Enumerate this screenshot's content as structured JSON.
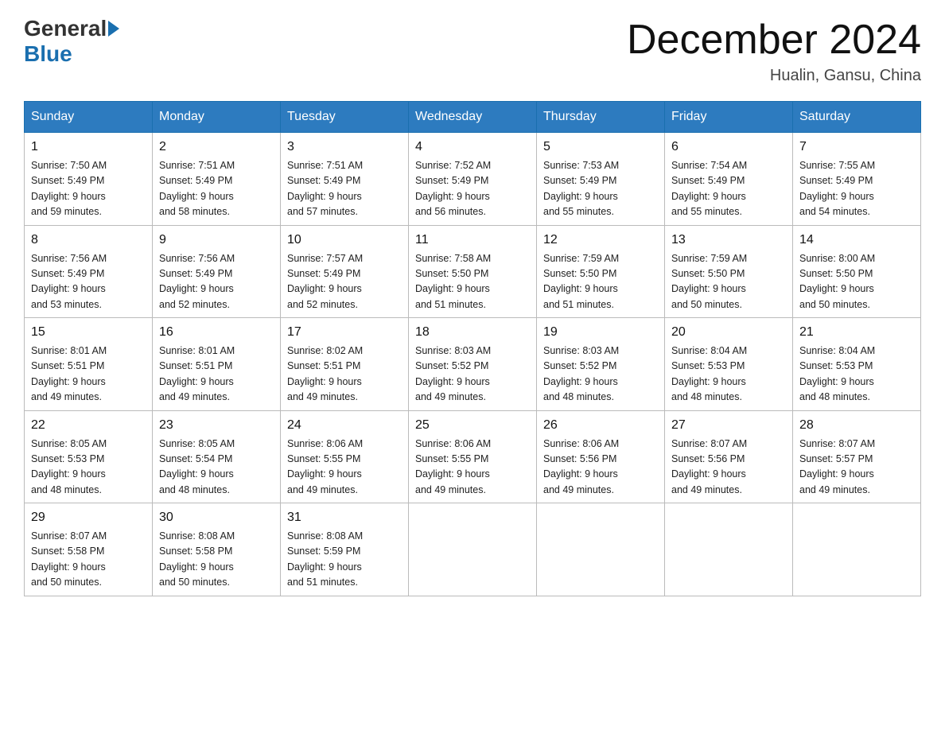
{
  "logo": {
    "general": "General",
    "blue": "Blue"
  },
  "title": "December 2024",
  "location": "Hualin, Gansu, China",
  "days_of_week": [
    "Sunday",
    "Monday",
    "Tuesday",
    "Wednesday",
    "Thursday",
    "Friday",
    "Saturday"
  ],
  "weeks": [
    [
      {
        "day": "1",
        "sunrise": "7:50 AM",
        "sunset": "5:49 PM",
        "daylight": "9 hours and 59 minutes."
      },
      {
        "day": "2",
        "sunrise": "7:51 AM",
        "sunset": "5:49 PM",
        "daylight": "9 hours and 58 minutes."
      },
      {
        "day": "3",
        "sunrise": "7:51 AM",
        "sunset": "5:49 PM",
        "daylight": "9 hours and 57 minutes."
      },
      {
        "day": "4",
        "sunrise": "7:52 AM",
        "sunset": "5:49 PM",
        "daylight": "9 hours and 56 minutes."
      },
      {
        "day": "5",
        "sunrise": "7:53 AM",
        "sunset": "5:49 PM",
        "daylight": "9 hours and 55 minutes."
      },
      {
        "day": "6",
        "sunrise": "7:54 AM",
        "sunset": "5:49 PM",
        "daylight": "9 hours and 55 minutes."
      },
      {
        "day": "7",
        "sunrise": "7:55 AM",
        "sunset": "5:49 PM",
        "daylight": "9 hours and 54 minutes."
      }
    ],
    [
      {
        "day": "8",
        "sunrise": "7:56 AM",
        "sunset": "5:49 PM",
        "daylight": "9 hours and 53 minutes."
      },
      {
        "day": "9",
        "sunrise": "7:56 AM",
        "sunset": "5:49 PM",
        "daylight": "9 hours and 52 minutes."
      },
      {
        "day": "10",
        "sunrise": "7:57 AM",
        "sunset": "5:49 PM",
        "daylight": "9 hours and 52 minutes."
      },
      {
        "day": "11",
        "sunrise": "7:58 AM",
        "sunset": "5:50 PM",
        "daylight": "9 hours and 51 minutes."
      },
      {
        "day": "12",
        "sunrise": "7:59 AM",
        "sunset": "5:50 PM",
        "daylight": "9 hours and 51 minutes."
      },
      {
        "day": "13",
        "sunrise": "7:59 AM",
        "sunset": "5:50 PM",
        "daylight": "9 hours and 50 minutes."
      },
      {
        "day": "14",
        "sunrise": "8:00 AM",
        "sunset": "5:50 PM",
        "daylight": "9 hours and 50 minutes."
      }
    ],
    [
      {
        "day": "15",
        "sunrise": "8:01 AM",
        "sunset": "5:51 PM",
        "daylight": "9 hours and 49 minutes."
      },
      {
        "day": "16",
        "sunrise": "8:01 AM",
        "sunset": "5:51 PM",
        "daylight": "9 hours and 49 minutes."
      },
      {
        "day": "17",
        "sunrise": "8:02 AM",
        "sunset": "5:51 PM",
        "daylight": "9 hours and 49 minutes."
      },
      {
        "day": "18",
        "sunrise": "8:03 AM",
        "sunset": "5:52 PM",
        "daylight": "9 hours and 49 minutes."
      },
      {
        "day": "19",
        "sunrise": "8:03 AM",
        "sunset": "5:52 PM",
        "daylight": "9 hours and 48 minutes."
      },
      {
        "day": "20",
        "sunrise": "8:04 AM",
        "sunset": "5:53 PM",
        "daylight": "9 hours and 48 minutes."
      },
      {
        "day": "21",
        "sunrise": "8:04 AM",
        "sunset": "5:53 PM",
        "daylight": "9 hours and 48 minutes."
      }
    ],
    [
      {
        "day": "22",
        "sunrise": "8:05 AM",
        "sunset": "5:53 PM",
        "daylight": "9 hours and 48 minutes."
      },
      {
        "day": "23",
        "sunrise": "8:05 AM",
        "sunset": "5:54 PM",
        "daylight": "9 hours and 48 minutes."
      },
      {
        "day": "24",
        "sunrise": "8:06 AM",
        "sunset": "5:55 PM",
        "daylight": "9 hours and 49 minutes."
      },
      {
        "day": "25",
        "sunrise": "8:06 AM",
        "sunset": "5:55 PM",
        "daylight": "9 hours and 49 minutes."
      },
      {
        "day": "26",
        "sunrise": "8:06 AM",
        "sunset": "5:56 PM",
        "daylight": "9 hours and 49 minutes."
      },
      {
        "day": "27",
        "sunrise": "8:07 AM",
        "sunset": "5:56 PM",
        "daylight": "9 hours and 49 minutes."
      },
      {
        "day": "28",
        "sunrise": "8:07 AM",
        "sunset": "5:57 PM",
        "daylight": "9 hours and 49 minutes."
      }
    ],
    [
      {
        "day": "29",
        "sunrise": "8:07 AM",
        "sunset": "5:58 PM",
        "daylight": "9 hours and 50 minutes."
      },
      {
        "day": "30",
        "sunrise": "8:08 AM",
        "sunset": "5:58 PM",
        "daylight": "9 hours and 50 minutes."
      },
      {
        "day": "31",
        "sunrise": "8:08 AM",
        "sunset": "5:59 PM",
        "daylight": "9 hours and 51 minutes."
      },
      null,
      null,
      null,
      null
    ]
  ],
  "labels": {
    "sunrise": "Sunrise:",
    "sunset": "Sunset:",
    "daylight": "Daylight:"
  }
}
